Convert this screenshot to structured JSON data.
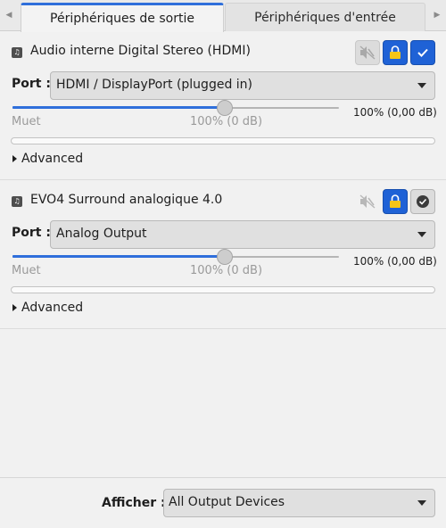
{
  "tabs": [
    {
      "label": "Périphériques de sortie",
      "active": true
    },
    {
      "label": "Périphériques d'entrée",
      "active": false
    }
  ],
  "devices": [
    {
      "name": "Audio interne Digital Stereo (HDMI)",
      "port_label": "Port :",
      "port_value": "HDMI / DisplayPort (plugged in)",
      "volume_readout": "100% (0,00 dB)",
      "volume_fraction": 0.65,
      "mute_mark": "Muet",
      "unity_mark": "100% (0 dB)",
      "advanced_label": "Advanced",
      "is_default": true
    },
    {
      "name": "EVO4 Surround analogique 4.0",
      "port_label": "Port :",
      "port_value": "Analog Output",
      "volume_readout": "100% (0,00 dB)",
      "volume_fraction": 0.65,
      "mute_mark": "Muet",
      "unity_mark": "100% (0 dB)",
      "advanced_label": "Advanced",
      "is_default": false
    }
  ],
  "footer": {
    "label": "Afficher :",
    "value": "All Output Devices"
  },
  "colors": {
    "accent": "#2f6fdb",
    "button_active": "#1f62d6",
    "lock_icon": "#f5c518"
  },
  "icons": {
    "device": "music-note-icon",
    "mute": "speaker-muted-icon",
    "lock": "lock-icon",
    "default": "checkmark-icon"
  }
}
